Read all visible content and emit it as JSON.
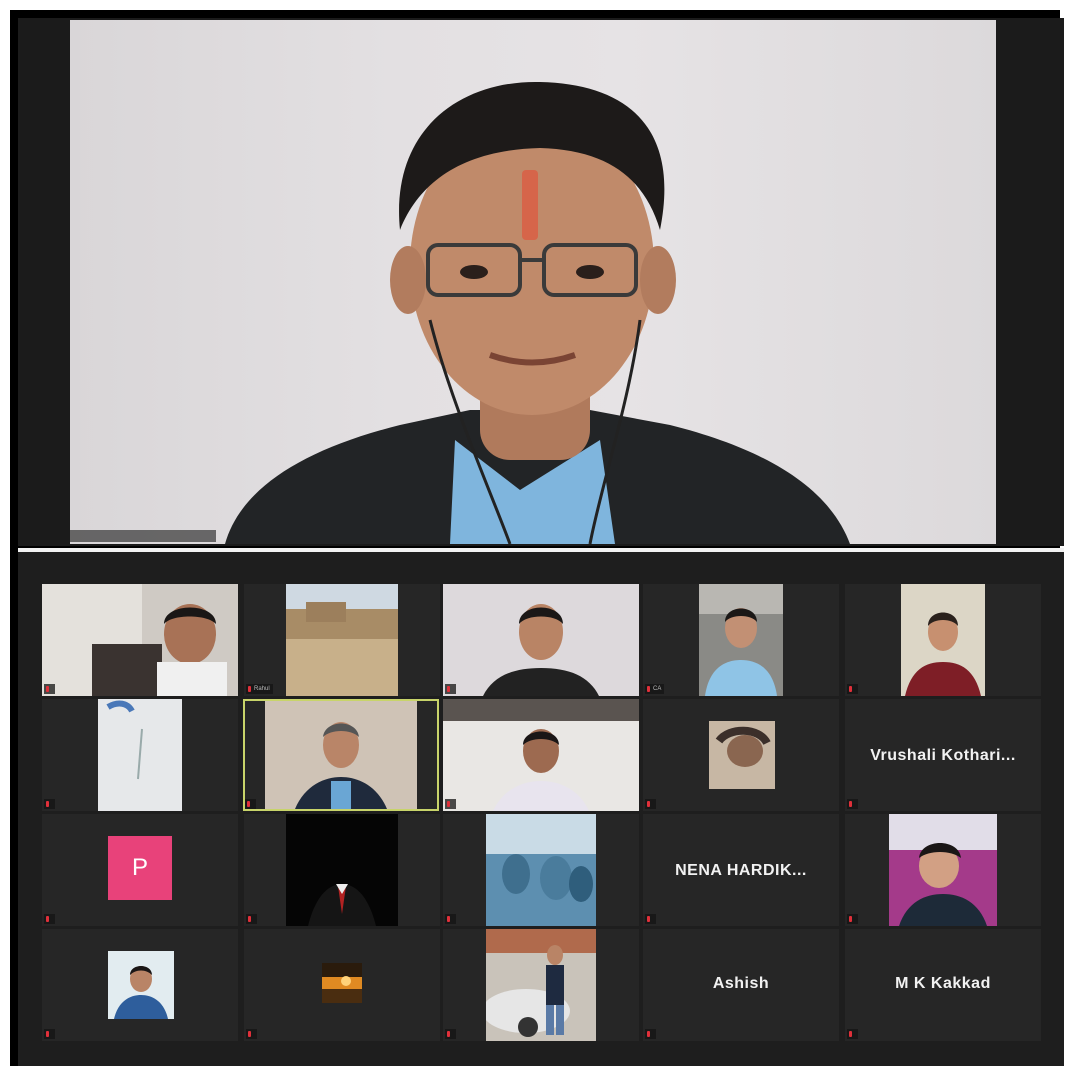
{
  "speaker": {
    "name": ""
  },
  "gallery": {
    "tiles": [
      {
        "name": "",
        "big": "",
        "kind": "video"
      },
      {
        "name": "Rahul",
        "big": "",
        "kind": "video"
      },
      {
        "name": "",
        "big": "",
        "kind": "video"
      },
      {
        "name": "CA",
        "big": "",
        "kind": "video"
      },
      {
        "name": "",
        "big": "",
        "kind": "video"
      },
      {
        "name": "",
        "big": "",
        "kind": "video"
      },
      {
        "name": "",
        "big": "",
        "kind": "video",
        "active": true
      },
      {
        "name": "",
        "big": "",
        "kind": "video"
      },
      {
        "name": "",
        "big": "",
        "kind": "video"
      },
      {
        "name": "",
        "big": "Vrushali  Kothari...",
        "kind": "text"
      },
      {
        "name": "",
        "big": "P",
        "kind": "avatar"
      },
      {
        "name": "",
        "big": "",
        "kind": "video"
      },
      {
        "name": "",
        "big": "",
        "kind": "video"
      },
      {
        "name": "",
        "big": "NENA   HARDIK...",
        "kind": "text"
      },
      {
        "name": "",
        "big": "",
        "kind": "video"
      },
      {
        "name": "",
        "big": "",
        "kind": "video"
      },
      {
        "name": "",
        "big": "",
        "kind": "video"
      },
      {
        "name": "",
        "big": "",
        "kind": "video"
      },
      {
        "name": "",
        "big": "Ashish",
        "kind": "text"
      },
      {
        "name": "",
        "big": "M K Kakkad",
        "kind": "text"
      }
    ]
  },
  "colors": {
    "active_border": "#c8d46a",
    "mic_muted": "#e0303a",
    "avatar_bg": "#e8427a",
    "tile_bg": "#262626"
  }
}
